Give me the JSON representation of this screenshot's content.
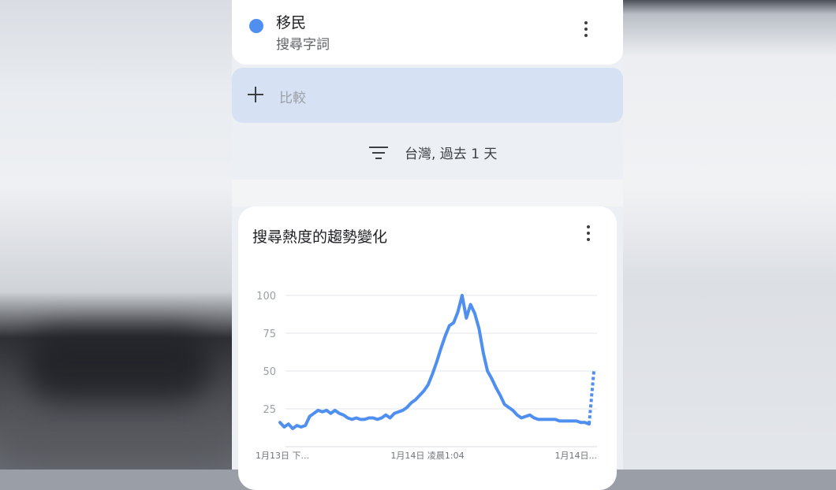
{
  "term": {
    "name": "移民",
    "type": "搜尋字詞",
    "dot_color": "#4f8ff0"
  },
  "compare": {
    "label": "比較"
  },
  "filter": {
    "text": "台灣, 過去 1 天"
  },
  "chart_card": {
    "title": "搜尋熱度的趨勢變化"
  },
  "chart_data": {
    "type": "line",
    "title": "搜尋熱度的趨勢變化",
    "ylim": [
      0,
      100
    ],
    "yticks": [
      "25",
      "50",
      "75",
      "100"
    ],
    "xticks": [
      "1月13日 下...",
      "1月14日 凌晨1:04",
      "1月14日..."
    ],
    "grid": true,
    "color": "#4f8ff0",
    "series": [
      {
        "values": [
          16,
          13,
          15,
          12,
          14,
          13,
          14,
          20,
          22,
          24,
          23,
          24,
          22,
          24,
          22,
          21,
          19,
          18,
          19,
          18,
          18,
          19,
          19,
          18,
          19,
          21,
          19,
          22,
          23,
          24,
          26,
          29,
          31,
          34,
          37,
          41,
          48,
          56,
          65,
          73,
          80,
          82,
          89,
          100,
          85,
          94,
          88,
          78,
          62,
          50,
          45,
          39,
          34,
          28,
          26,
          24,
          21,
          19,
          20,
          21,
          19,
          18,
          18,
          18,
          18,
          18,
          17,
          17,
          17,
          17,
          17,
          16,
          16,
          15
        ],
        "partial_tail": [
          15,
          50
        ]
      }
    ]
  }
}
